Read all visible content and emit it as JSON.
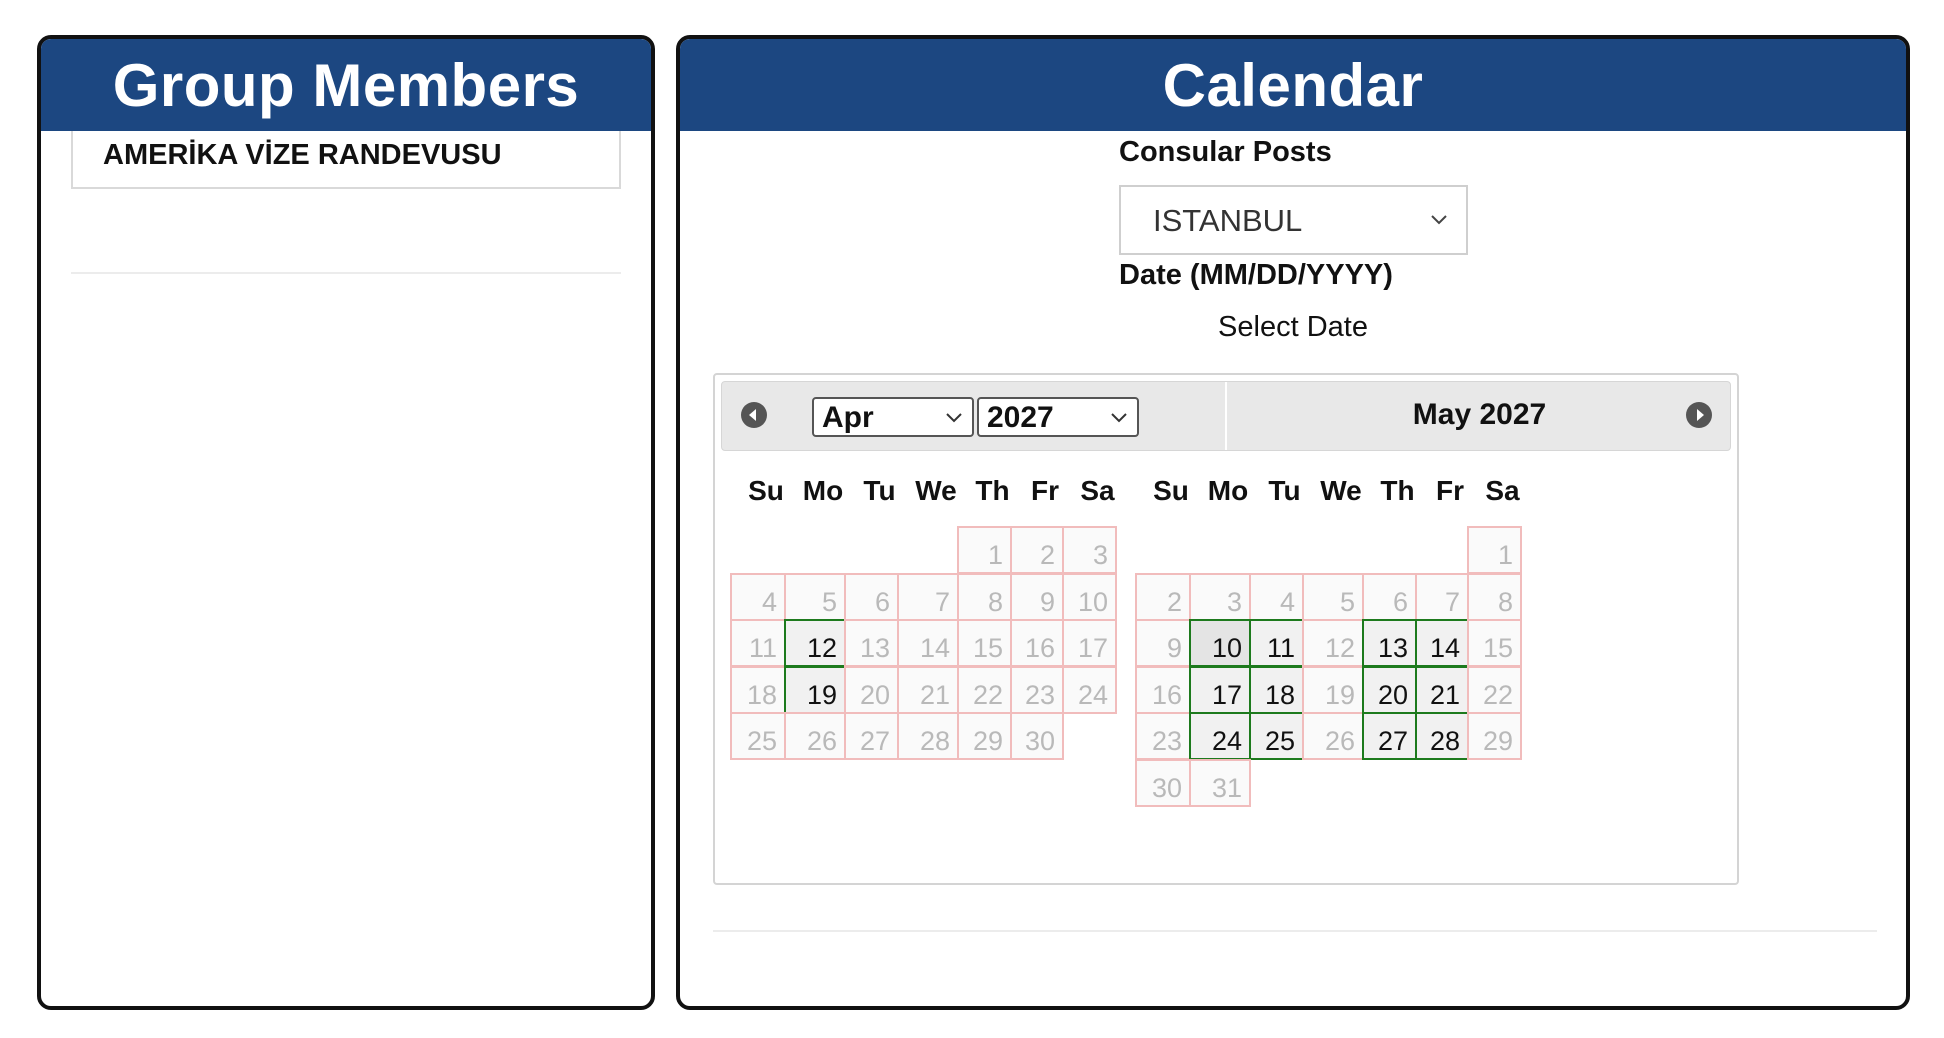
{
  "group_panel": {
    "title": "Group Members",
    "member": "AMERİKA VİZE RANDEVUSU"
  },
  "calendar_panel": {
    "title": "Calendar",
    "post_label": "Consular Posts",
    "post_value": "ISTANBUL",
    "date_label": "Date (MM/DD/YYYY)",
    "select_date_text": "Select Date"
  },
  "datepicker": {
    "prev_icon": "chevron-left-circle-icon",
    "next_icon": "chevron-right-circle-icon",
    "weekdays": [
      "Su",
      "Mo",
      "Tu",
      "We",
      "Th",
      "Fr",
      "Sa"
    ],
    "months": [
      {
        "month_select": "Apr",
        "year_select": "2027",
        "title": "",
        "first_weekday": 4,
        "days_in_month": 30,
        "available": [
          12,
          19
        ],
        "highlighted": []
      },
      {
        "month_select": "",
        "year_select": "",
        "title": "May 2027",
        "first_weekday": 6,
        "days_in_month": 31,
        "available": [
          10,
          11,
          13,
          14,
          17,
          18,
          20,
          21,
          24,
          25,
          27,
          28
        ],
        "highlighted": [
          10
        ]
      }
    ]
  },
  "colors": {
    "header_blue": "#1c4781",
    "available_border": "#1d7a1d",
    "unavailable_border": "#f1bcbc"
  }
}
